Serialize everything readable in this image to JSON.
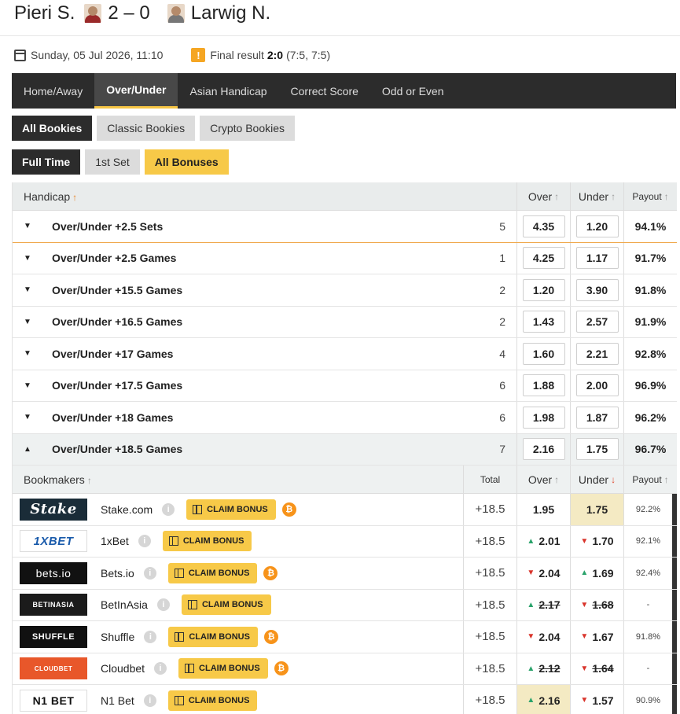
{
  "match": {
    "home": "Pieri S.",
    "away": "Larwig N.",
    "score": "2 – 0",
    "date": "Sunday, 05 Jul 2026, 11:10",
    "result_label": "Final result",
    "result_score": "2:0",
    "result_sets": "(7:5, 7:5)"
  },
  "tabs": [
    "Home/Away",
    "Over/Under",
    "Asian Handicap",
    "Correct Score",
    "Odd or Even"
  ],
  "bookie_filters": [
    "All Bookies",
    "Classic Bookies",
    "Crypto Bookies"
  ],
  "period_filters": [
    "Full Time",
    "1st Set",
    "All Bonuses"
  ],
  "table_header": {
    "handicap": "Handicap",
    "over": "Over",
    "under": "Under",
    "payout": "Payout"
  },
  "markets": [
    {
      "name": "Over/Under +2.5 Sets",
      "count": "5",
      "over": "4.35",
      "under": "1.20",
      "payout": "94.1%"
    },
    {
      "name": "Over/Under +2.5 Games",
      "count": "1",
      "over": "4.25",
      "under": "1.17",
      "payout": "91.7%"
    },
    {
      "name": "Over/Under +15.5 Games",
      "count": "2",
      "over": "1.20",
      "under": "3.90",
      "payout": "91.8%"
    },
    {
      "name": "Over/Under +16.5 Games",
      "count": "2",
      "over": "1.43",
      "under": "2.57",
      "payout": "91.9%"
    },
    {
      "name": "Over/Under +17 Games",
      "count": "4",
      "over": "1.60",
      "under": "2.21",
      "payout": "92.8%"
    },
    {
      "name": "Over/Under +17.5 Games",
      "count": "6",
      "over": "1.88",
      "under": "2.00",
      "payout": "96.9%"
    },
    {
      "name": "Over/Under +18 Games",
      "count": "6",
      "over": "1.98",
      "under": "1.87",
      "payout": "96.2%"
    },
    {
      "name": "Over/Under +18.5 Games",
      "count": "7",
      "over": "2.16",
      "under": "1.75",
      "payout": "96.7%"
    }
  ],
  "bookmaker_header": {
    "bookmakers": "Bookmakers",
    "total": "Total",
    "over": "Over",
    "under": "Under",
    "payout": "Payout"
  },
  "bookmakers": [
    {
      "logo": "Stake",
      "name": "Stake.com",
      "bonus": "CLAIM BONUS",
      "crypto": true,
      "total": "+18.5",
      "over": "1.95",
      "under": "1.75",
      "payout": "92.2%"
    },
    {
      "logo": "1XBET",
      "name": "1xBet",
      "bonus": "CLAIM BONUS",
      "crypto": false,
      "total": "+18.5",
      "over": "2.01",
      "under": "1.70",
      "payout": "92.1%"
    },
    {
      "logo": "bets.io",
      "name": "Bets.io",
      "bonus": "CLAIM BONUS",
      "crypto": true,
      "total": "+18.5",
      "over": "2.04",
      "under": "1.69",
      "payout": "92.4%"
    },
    {
      "logo": "BETINASIA",
      "name": "BetInAsia",
      "bonus": "CLAIM BONUS",
      "crypto": false,
      "total": "+18.5",
      "over": "2.17",
      "under": "1.68",
      "payout": "-"
    },
    {
      "logo": "SHUFFLE",
      "name": "Shuffle",
      "bonus": "CLAIM BONUS",
      "crypto": true,
      "total": "+18.5",
      "over": "2.04",
      "under": "1.67",
      "payout": "91.8%"
    },
    {
      "logo": "CLOUDBET",
      "name": "Cloudbet",
      "bonus": "CLAIM BONUS",
      "crypto": true,
      "total": "+18.5",
      "over": "2.12",
      "under": "1.64",
      "payout": "-"
    },
    {
      "logo": "N1 BET",
      "name": "N1 Bet",
      "bonus": "CLAIM BONUS",
      "crypto": false,
      "total": "+18.5",
      "over": "2.16",
      "under": "1.57",
      "payout": "90.9%"
    }
  ],
  "colors": {
    "accent": "#f7c948",
    "dark": "#2c2c2c",
    "up": "#2aa36b",
    "down": "#d9342b"
  }
}
